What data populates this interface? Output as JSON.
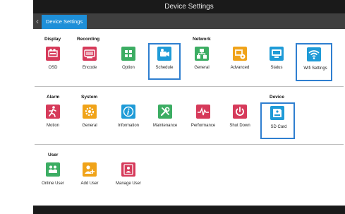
{
  "window": {
    "title": "Device Settings"
  },
  "tabbar": {
    "back_glyph": "‹",
    "active_tab": "Device Settings"
  },
  "sections": {
    "display": "Display",
    "recording": "Recording",
    "network": "Network",
    "alarm": "Alarm",
    "system": "System",
    "device": "Device",
    "user": "User"
  },
  "items": {
    "osd": {
      "label": "OSD",
      "icon": "osd-icon",
      "color": "#d63a5a"
    },
    "encode": {
      "label": "Encode",
      "icon": "encode-icon",
      "color": "#d63a5a"
    },
    "option": {
      "label": "Option",
      "icon": "option-icon",
      "color": "#3cad63"
    },
    "schedule": {
      "label": "Schedule",
      "icon": "schedule-icon",
      "color": "#1f9bd7"
    },
    "general_net": {
      "label": "General",
      "icon": "network-general-icon",
      "color": "#3cad63"
    },
    "advanced": {
      "label": "Advanced",
      "icon": "advanced-icon",
      "color": "#f0a319"
    },
    "status": {
      "label": "Status",
      "icon": "status-icon",
      "color": "#1f9bd7"
    },
    "wifi": {
      "label": "Wifi Settings",
      "icon": "wifi-icon",
      "color": "#1f9bd7"
    },
    "motion": {
      "label": "Motion",
      "icon": "motion-icon",
      "color": "#d63a5a"
    },
    "general_sys": {
      "label": "General",
      "icon": "system-general-icon",
      "color": "#f0a319"
    },
    "information": {
      "label": "Information",
      "icon": "information-icon",
      "color": "#1f9bd7"
    },
    "maintenance": {
      "label": "Maintenance",
      "icon": "maintenance-icon",
      "color": "#3cad63"
    },
    "performance": {
      "label": "Performance",
      "icon": "performance-icon",
      "color": "#d63a5a"
    },
    "shutdown": {
      "label": "Shut Down",
      "icon": "power-icon",
      "color": "#d63a5a"
    },
    "sdcard": {
      "label": "SD Card",
      "icon": "sd-card-icon",
      "color": "#1f9bd7"
    },
    "online_user": {
      "label": "Online User",
      "icon": "online-user-icon",
      "color": "#3cad63"
    },
    "add_user": {
      "label": "Add User",
      "icon": "add-user-icon",
      "color": "#f0a319"
    },
    "manage_user": {
      "label": "Manage User",
      "icon": "manage-user-icon",
      "color": "#d63a5a"
    }
  },
  "colors": {
    "accent": "#1e8fd8",
    "selection": "#2f7fd0"
  }
}
